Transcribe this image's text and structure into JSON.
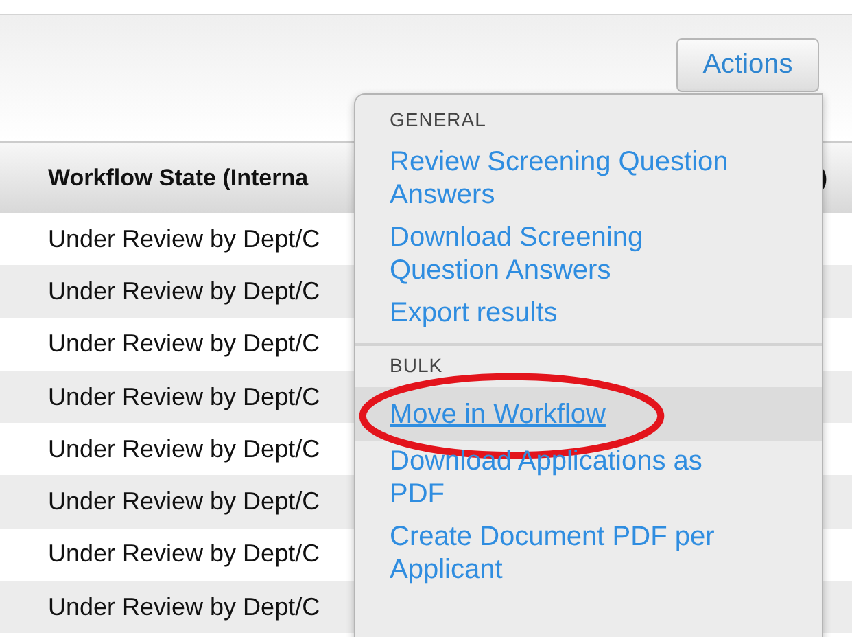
{
  "toolbar": {
    "actions_button": "Actions"
  },
  "table": {
    "columns": [
      "Workflow State (Interna",
      ")"
    ],
    "rows": [
      {
        "column_1": "Under Review by Dept/C"
      },
      {
        "column_1": "Under Review by Dept/C"
      },
      {
        "column_1": "Under Review by Dept/C"
      },
      {
        "column_1": "Under Review by Dept/C"
      },
      {
        "column_1": "Under Review by Dept/C"
      },
      {
        "column_1": "Under Review by Dept/C"
      },
      {
        "column_1": "Under Review by Dept/C"
      },
      {
        "column_1": "Under Review by Dept/C"
      }
    ]
  },
  "actions_menu": {
    "sections": [
      {
        "heading": "GENERAL",
        "items": [
          {
            "label": "Review Screening Question Answers",
            "selected": false
          },
          {
            "label": "Download Screening Question Answers",
            "selected": false
          },
          {
            "label": "Export results",
            "selected": false
          }
        ]
      },
      {
        "heading": "BULK",
        "items": [
          {
            "label": "Move in Workflow",
            "selected": true
          },
          {
            "label": "Download Applications as PDF",
            "selected": false
          },
          {
            "label": "Create Document PDF per Applicant",
            "selected": false
          }
        ]
      }
    ]
  },
  "annotation": {
    "kind": "ellipse"
  }
}
